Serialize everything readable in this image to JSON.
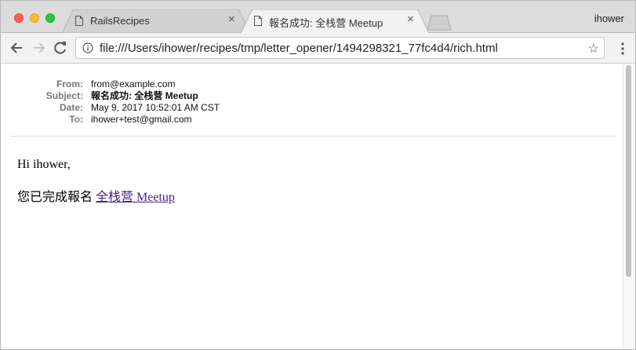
{
  "browser": {
    "profile_name": "ihower",
    "tabs": [
      {
        "title": "RailsRecipes",
        "active": false,
        "close": "×"
      },
      {
        "title": "報名成功: 全栈营 Meetup",
        "active": true,
        "close": "×"
      }
    ],
    "address_bar": {
      "url": "file:///Users/ihower/recipes/tmp/letter_opener/1494298321_77fc4d4/rich.html",
      "bookmark_icon": "☆"
    }
  },
  "email": {
    "headers": [
      {
        "label": "From:",
        "value": "from@example.com",
        "bold": false
      },
      {
        "label": "Subject:",
        "value": "報名成功: 全栈营 Meetup",
        "bold": true
      },
      {
        "label": "Date:",
        "value": "May 9, 2017 10:52:01 AM CST",
        "bold": false
      },
      {
        "label": "To:",
        "value": "ihower+test@gmail.com",
        "bold": false
      }
    ],
    "greeting": "Hi ihower,",
    "message_prefix": "您已完成報名 ",
    "link_text": "全栈营 Meetup"
  },
  "colors": {
    "tab_strip": "#dcdcdc",
    "toolbar": "#f2f2f2",
    "link": "#4b1c8a",
    "header_label": "#777777"
  }
}
